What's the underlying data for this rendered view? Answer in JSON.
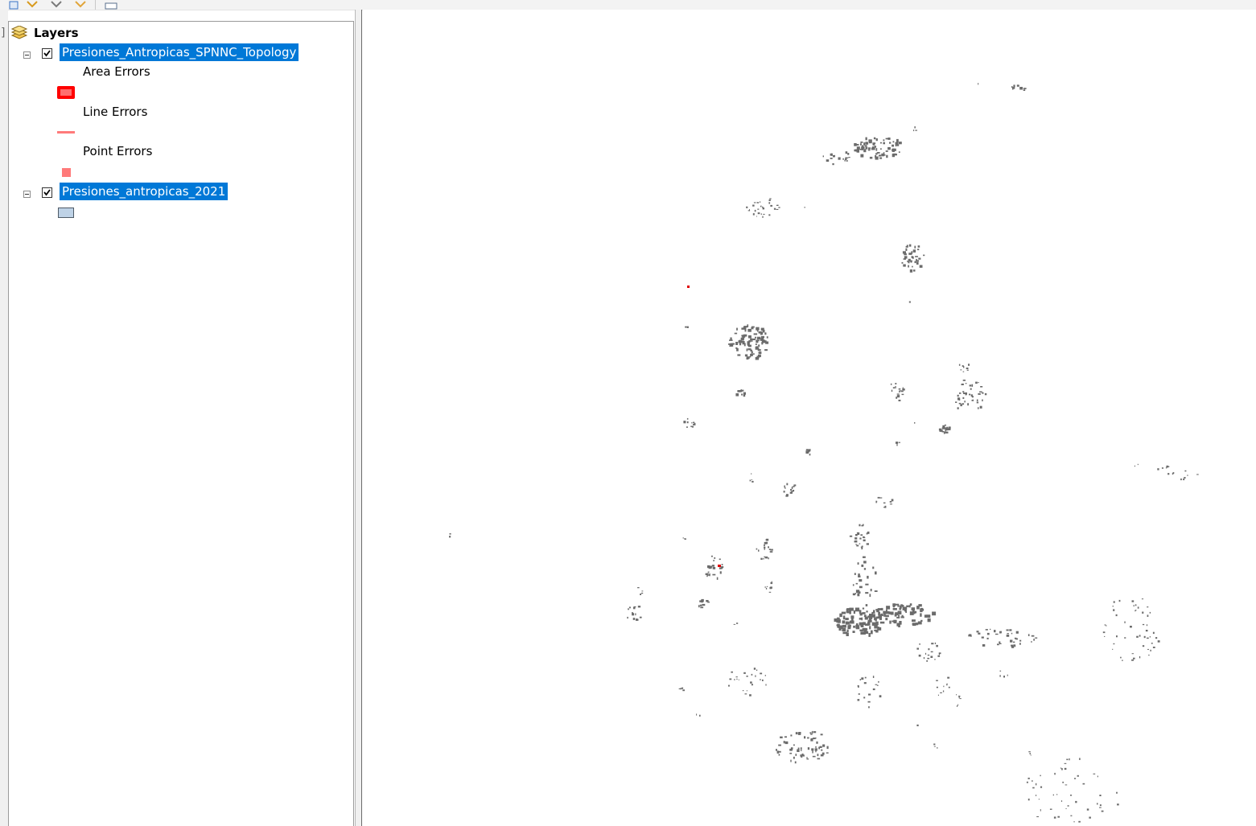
{
  "toc": {
    "root_label": "Layers",
    "layers": [
      {
        "name": "Presiones_Antropicas_SPNNC_Topology",
        "checked": true,
        "legend": [
          {
            "label": "Area Errors",
            "symbol": "area",
            "color": "#ff0000"
          },
          {
            "label": "Line Errors",
            "symbol": "line",
            "color": "#ff7a7a"
          },
          {
            "label": "Point Errors",
            "symbol": "point",
            "color": "#ff7a7a"
          }
        ]
      },
      {
        "name": "Presiones_antropicas_2021",
        "checked": true,
        "legend": [
          {
            "label": "",
            "symbol": "polygon",
            "color": "#bed2e6"
          }
        ]
      }
    ]
  },
  "colors": {
    "selection": "#0078d7",
    "feature_fill": "#6b6b6b",
    "error_fill": "#e00000"
  },
  "icons": [
    "layers-icon",
    "expander-minus-icon",
    "checkbox-checked-icon"
  ]
}
